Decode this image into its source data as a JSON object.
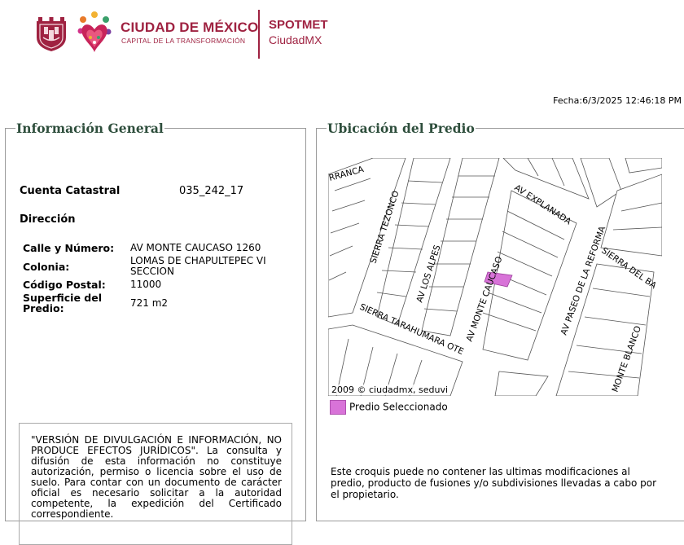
{
  "header": {
    "city_title": "CIUDAD DE MÉXICO",
    "city_subtitle": "CAPITAL DE LA TRANSFORMACIÓN",
    "app_name_line1": "SPOTMET",
    "app_name_line2": "CiudadMX",
    "brand_color": "#9f2241"
  },
  "fecha": "Fecha:6/3/2025 12:46:18 PM",
  "info": {
    "title": "Información General",
    "cuenta_label": "Cuenta Catastral",
    "cuenta_value": "035_242_17",
    "direccion_label": "Dirección",
    "rows": [
      {
        "label": "Calle y Número:",
        "value": "AV MONTE CAUCASO 1260"
      },
      {
        "label": "Colonia:",
        "value": "LOMAS DE CHAPULTEPEC VI SECCION"
      },
      {
        "label": "Código Postal:",
        "value": "11000"
      },
      {
        "label": "Superficie del Predio:",
        "value": "721 m2"
      }
    ],
    "disclaimer": "\"VERSIÓN DE DIVULGACIÓN E INFORMACIÓN, NO PRODUCE EFECTOS JURÍDICOS\". La consulta y difusión de esta información no constituye autorización, permiso o licencia sobre el uso de suelo. Para contar con un documento de carácter oficial es necesario solicitar a la autoridad competente, la expedición del Certificado correspondiente."
  },
  "map": {
    "title": "Ubicación del Predio",
    "streets": [
      "RRANCA",
      "SIERRA TEZONCO",
      "AV LOS ALPES",
      "AV MONTE CAUCASO",
      "AV EXPLANADA",
      "AV PASEO DE LA REFORMA",
      "SIERRA DEL BA",
      "SIERRA TARAHUMARA OTE",
      "MONTE BLANCO"
    ],
    "copyright": "2009 © ciudadmx, seduvi",
    "legend_label": "Predio Seleccionado",
    "selected_color": "#d873d8",
    "note": "Este croquis puede no contener las ultimas modificaciones al predio, producto de fusiones y/o subdivisiones llevadas a cabo por el propietario."
  }
}
